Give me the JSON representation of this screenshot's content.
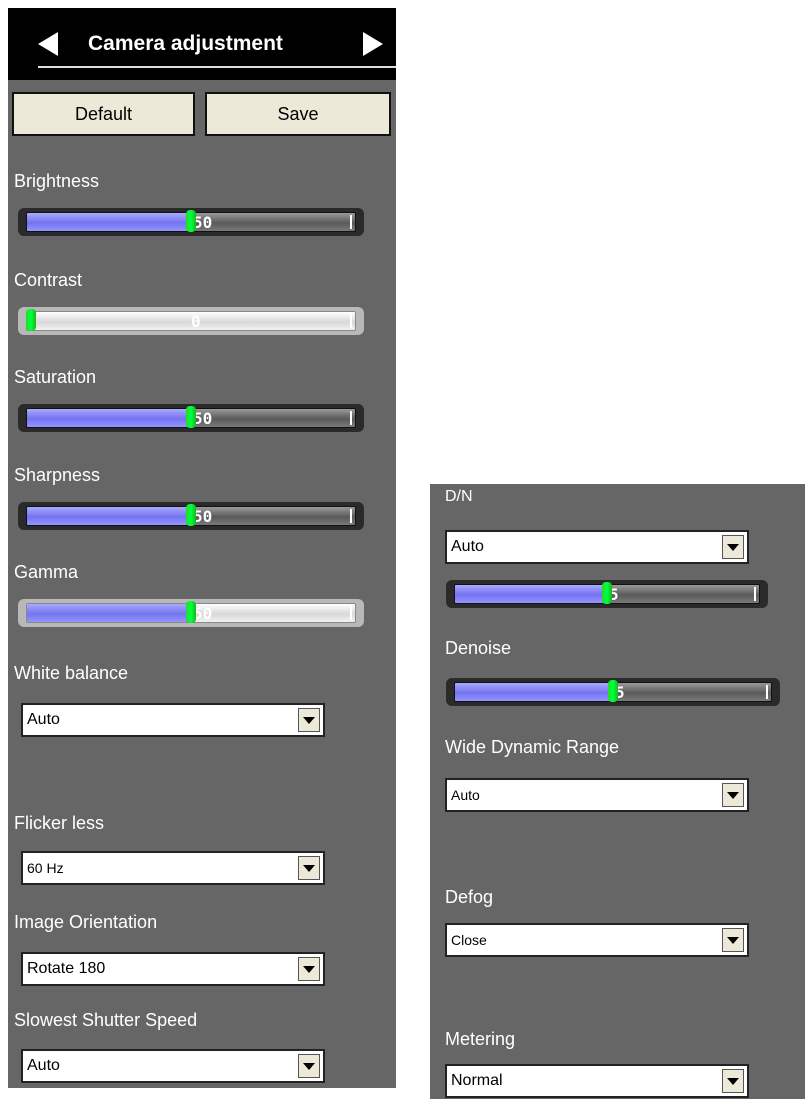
{
  "header": {
    "title": "Camera adjustment"
  },
  "buttons": {
    "default": "Default",
    "save": "Save"
  },
  "sliders": {
    "brightness": {
      "label": "Brightness",
      "value": "50",
      "percent": 0.5
    },
    "contrast": {
      "label": "Contrast",
      "value": "0",
      "percent": 0.0
    },
    "saturation": {
      "label": "Saturation",
      "value": "50",
      "percent": 0.5
    },
    "sharpness": {
      "label": "Sharpness",
      "value": "50",
      "percent": 0.5
    },
    "gamma": {
      "label": "Gamma",
      "value": "50",
      "percent": 0.5
    },
    "dn": {
      "value": "5",
      "percent": 0.5
    },
    "denoise": {
      "label": "Denoise",
      "value": "5",
      "percent": 0.5
    }
  },
  "selects": {
    "white_balance": {
      "label": "White balance",
      "value": "Auto"
    },
    "flicker": {
      "label": "Flicker less",
      "value": "60 Hz"
    },
    "orientation": {
      "label": "Image Orientation",
      "value": "Rotate 180"
    },
    "shutter": {
      "label": "Slowest Shutter Speed",
      "value": "Auto"
    },
    "dn": {
      "label": "D/N",
      "value": "Auto"
    },
    "wdr": {
      "label": "Wide Dynamic Range",
      "value": "Auto"
    },
    "defog": {
      "label": "Defog",
      "value": "Close"
    },
    "metering": {
      "label": "Metering",
      "value": "Normal"
    }
  }
}
